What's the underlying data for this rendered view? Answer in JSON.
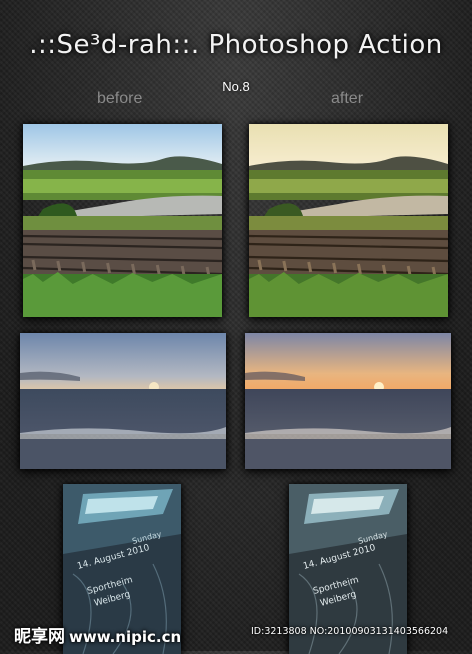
{
  "header": {
    "title": ".::Se³d-rah::. Photoshop Action",
    "subtitle": "No.8"
  },
  "labels": {
    "before": "before",
    "after": "after"
  },
  "images": [
    {
      "name": "railway-landscape",
      "before_icon": "railway-landscape-before",
      "after_icon": "railway-landscape-after"
    },
    {
      "name": "beach-sunset",
      "before_icon": "beach-sunset-before",
      "after_icon": "beach-sunset-after"
    },
    {
      "name": "event-flyer",
      "before_icon": "flyer-before",
      "after_icon": "flyer-after"
    }
  ],
  "flyer_text": {
    "line1": "Sunday",
    "line2": "14. August 2010",
    "line3": "Sportheim",
    "line4": "Weiberg"
  },
  "watermark": {
    "site": "昵享网",
    "url": "www.nipic.cn",
    "id_line": "ID:3213808 NO:20100903131403566204"
  },
  "colors": {
    "background": "#262626",
    "title": "#f2f2f2",
    "label": "#8a8a8a"
  }
}
